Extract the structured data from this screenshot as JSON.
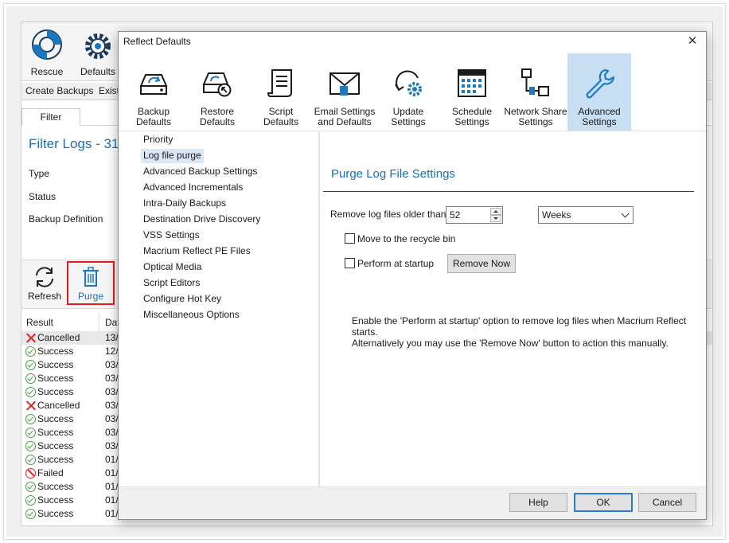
{
  "background_app": {
    "toolbar": [
      {
        "label": "Rescue",
        "icon": "lifebuoy-icon"
      },
      {
        "label": "Defaults",
        "icon": "gear-icon"
      }
    ],
    "tabs": [
      "Create Backups",
      "Existi"
    ],
    "subtab": "Filter",
    "heading": "Filter Logs - 31",
    "fields": [
      "Type",
      "Status",
      "Backup Definition"
    ],
    "actions": [
      {
        "label": "Refresh",
        "icon": "refresh-icon"
      },
      {
        "label": "Purge",
        "icon": "trash-icon"
      }
    ],
    "grid_columns": [
      "Result",
      "Dat"
    ],
    "rows": [
      {
        "status": "Cancelled",
        "date": "13/",
        "kind": "cancelled"
      },
      {
        "status": "Success",
        "date": "12/",
        "kind": "success"
      },
      {
        "status": "Success",
        "date": "03/",
        "kind": "success"
      },
      {
        "status": "Success",
        "date": "03/",
        "kind": "success"
      },
      {
        "status": "Success",
        "date": "03/",
        "kind": "success"
      },
      {
        "status": "Cancelled",
        "date": "03/",
        "kind": "cancelled"
      },
      {
        "status": "Success",
        "date": "03/",
        "kind": "success"
      },
      {
        "status": "Success",
        "date": "03/",
        "kind": "success"
      },
      {
        "status": "Success",
        "date": "03/",
        "kind": "success"
      },
      {
        "status": "Success",
        "date": "01/",
        "kind": "success"
      },
      {
        "status": "Failed",
        "date": "01/",
        "kind": "failed"
      },
      {
        "status": "Success",
        "date": "01/",
        "kind": "success"
      },
      {
        "status": "Success",
        "date": "01/",
        "kind": "success"
      },
      {
        "status": "Success",
        "date": "01/",
        "kind": "success"
      }
    ]
  },
  "dialog": {
    "title": "Reflect Defaults",
    "close_glyph": "✕",
    "toolbar": [
      {
        "line1": "Backup",
        "line2": "Defaults",
        "icon": "backup-drive-icon"
      },
      {
        "line1": "Restore",
        "line2": "Defaults",
        "icon": "restore-drive-icon"
      },
      {
        "line1": "Script",
        "line2": "Defaults",
        "icon": "script-icon"
      },
      {
        "line1": "Email Settings",
        "line2": "and Defaults",
        "icon": "envelope-icon"
      },
      {
        "line1": "Update",
        "line2": "Settings",
        "icon": "update-gear-icon"
      },
      {
        "line1": "Schedule",
        "line2": "Settings",
        "icon": "calendar-icon"
      },
      {
        "line1": "Network Share",
        "line2": "Settings",
        "icon": "network-share-icon"
      },
      {
        "line1": "Advanced",
        "line2": "Settings",
        "icon": "wrench-icon"
      }
    ],
    "tree": [
      "Priority",
      "Log file purge",
      "Advanced Backup Settings",
      "Advanced Incrementals",
      "Intra-Daily Backups",
      "Destination Drive Discovery",
      "VSS Settings",
      "Macrium Reflect PE Files",
      "Optical Media",
      "Script Editors",
      "Configure Hot Key",
      "Miscellaneous Options"
    ],
    "panel": {
      "title": "Purge Log File Settings",
      "older_label": "Remove log files older than",
      "older_value": "52",
      "unit_value": "Weeks",
      "recycle_label": "Move to the recycle bin",
      "startup_label": "Perform at startup",
      "remove_now": "Remove Now",
      "help_line1": "Enable the 'Perform at startup' option to remove log files when Macrium Reflect starts.",
      "help_line2": "Alternatively you may use the 'Remove Now' button to action this manually."
    },
    "buttons": {
      "help": "Help",
      "ok": "OK",
      "cancel": "Cancel"
    }
  },
  "colors": {
    "accent": "#1a6fb8",
    "highlight_border": "#e31b23",
    "active_tab": "#c8def3"
  }
}
